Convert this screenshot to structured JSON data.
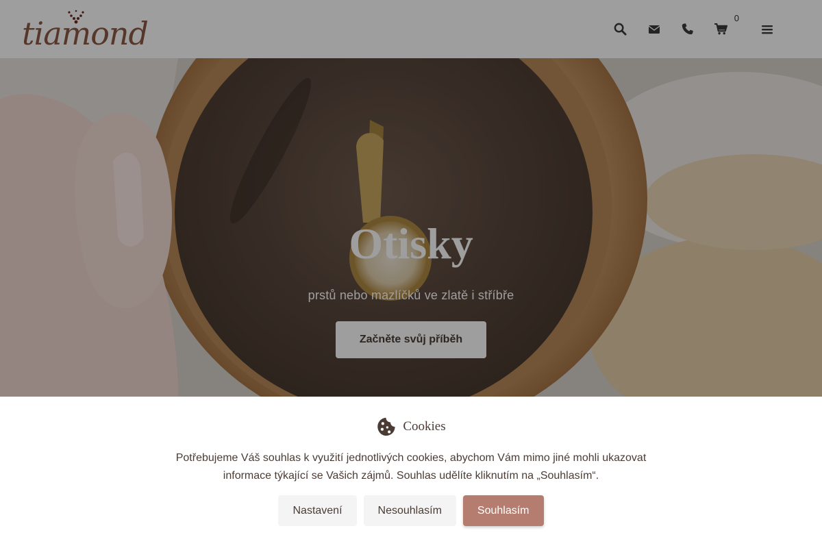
{
  "brand": {
    "logo_text": "tiamond",
    "logo_color": "#8b5a45"
  },
  "nav": {
    "icons": [
      "search-icon",
      "envelope-icon",
      "phone-icon",
      "cart-icon",
      "menu-icon"
    ],
    "cart_count": "0"
  },
  "hero": {
    "title": "Otisky",
    "subtitle": "prstů nebo mazlíčků ve zlatě i stříbře",
    "cta_label": "Začněte svůj příběh"
  },
  "cookies": {
    "icon": "cookie-icon",
    "title": "Cookies",
    "text": "Potřebujeme Váš souhlas k využití jednotlivých cookies, abychom Vám mimo jiné mohli ukazovat informace týkající se Vašich zájmů. Souhlas udělíte kliknutím na „Souhlasím“.",
    "settings_label": "Nastavení",
    "decline_label": "Nesouhlasím",
    "accept_label": "Souhlasím",
    "accent_color": "#b57d6f"
  }
}
